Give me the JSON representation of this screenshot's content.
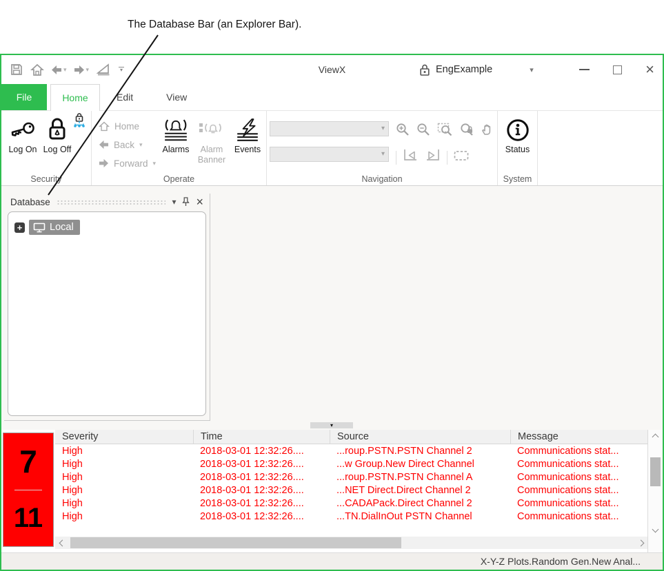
{
  "annotation": {
    "label": "The Database Bar (an Explorer Bar)."
  },
  "window": {
    "title": "ViewX",
    "document": "EngExample"
  },
  "tabs": {
    "file": "File",
    "home": "Home",
    "edit": "Edit",
    "view": "View"
  },
  "ribbon": {
    "security": {
      "group": "Security",
      "log_on": "Log On",
      "log_off": "Log Off"
    },
    "operate": {
      "group": "Operate",
      "home": "Home",
      "back": "Back",
      "forward": "Forward",
      "alarms": "Alarms",
      "alarm_banner": "Alarm Banner",
      "events": "Events"
    },
    "navigation": {
      "group": "Navigation"
    },
    "system": {
      "group": "System",
      "status": "Status"
    }
  },
  "database_panel": {
    "title": "Database",
    "local_label": "Local",
    "expand_glyph": "+"
  },
  "alarm_counts": {
    "top": "7",
    "bottom": "11"
  },
  "alarm_table": {
    "columns": [
      "Severity",
      "Time",
      "Source",
      "Message"
    ],
    "rows": [
      {
        "severity": "High",
        "time": "2018-03-01 12:32:26....",
        "source": "...roup.PSTN.PSTN Channel 2",
        "message": "Communications stat..."
      },
      {
        "severity": "High",
        "time": "2018-03-01 12:32:26....",
        "source": "...w Group.New Direct Channel",
        "message": "Communications stat..."
      },
      {
        "severity": "High",
        "time": "2018-03-01 12:32:26....",
        "source": "...roup.PSTN.PSTN Channel A",
        "message": "Communications stat..."
      },
      {
        "severity": "High",
        "time": "2018-03-01 12:32:26....",
        "source": "...NET Direct.Direct Channel 2",
        "message": "Communications stat..."
      },
      {
        "severity": "High",
        "time": "2018-03-01 12:32:26....",
        "source": "...CADAPack.Direct Channel 2",
        "message": "Communications stat..."
      },
      {
        "severity": "High",
        "time": "2018-03-01 12:32:26....",
        "source": "...TN.DialInOut PSTN Channel",
        "message": "Communications stat..."
      }
    ]
  },
  "status_bar": {
    "text": "X-Y-Z Plots.Random Gen.New Anal..."
  },
  "colors": {
    "accent_green": "#2EBD4F",
    "alarm_red": "#FF0000"
  },
  "icons": {
    "save": "floppy-disk",
    "home": "house",
    "back": "arrow-left",
    "forward": "arrow-right",
    "design_mode": "set-square",
    "customize": "bar-chevron-down",
    "document_lock": "padlock",
    "minimize": "dash",
    "maximize": "square",
    "close": "x",
    "log_on": "key",
    "log_off": "padlock",
    "security_policy": "network-lock",
    "alarms": "bell-over-lines",
    "alarm_banner": "banner-bell",
    "events": "lightning-over-lines",
    "zoom_in": "magnifier-plus",
    "zoom_out": "magnifier-minus",
    "zoom_original": "magnifier-box",
    "zoom_lock": "magnifier-lock",
    "pan": "hand",
    "previous_view": "hollow-arrow-left",
    "next_view": "hollow-arrow-right",
    "zoom_area": "dashed-rect",
    "status": "info-circle",
    "tree_expand": "plus-box",
    "local_node": "computer-monitor",
    "panel_menu": "chevron-down",
    "panel_pin": "push-pin",
    "panel_close": "x"
  }
}
